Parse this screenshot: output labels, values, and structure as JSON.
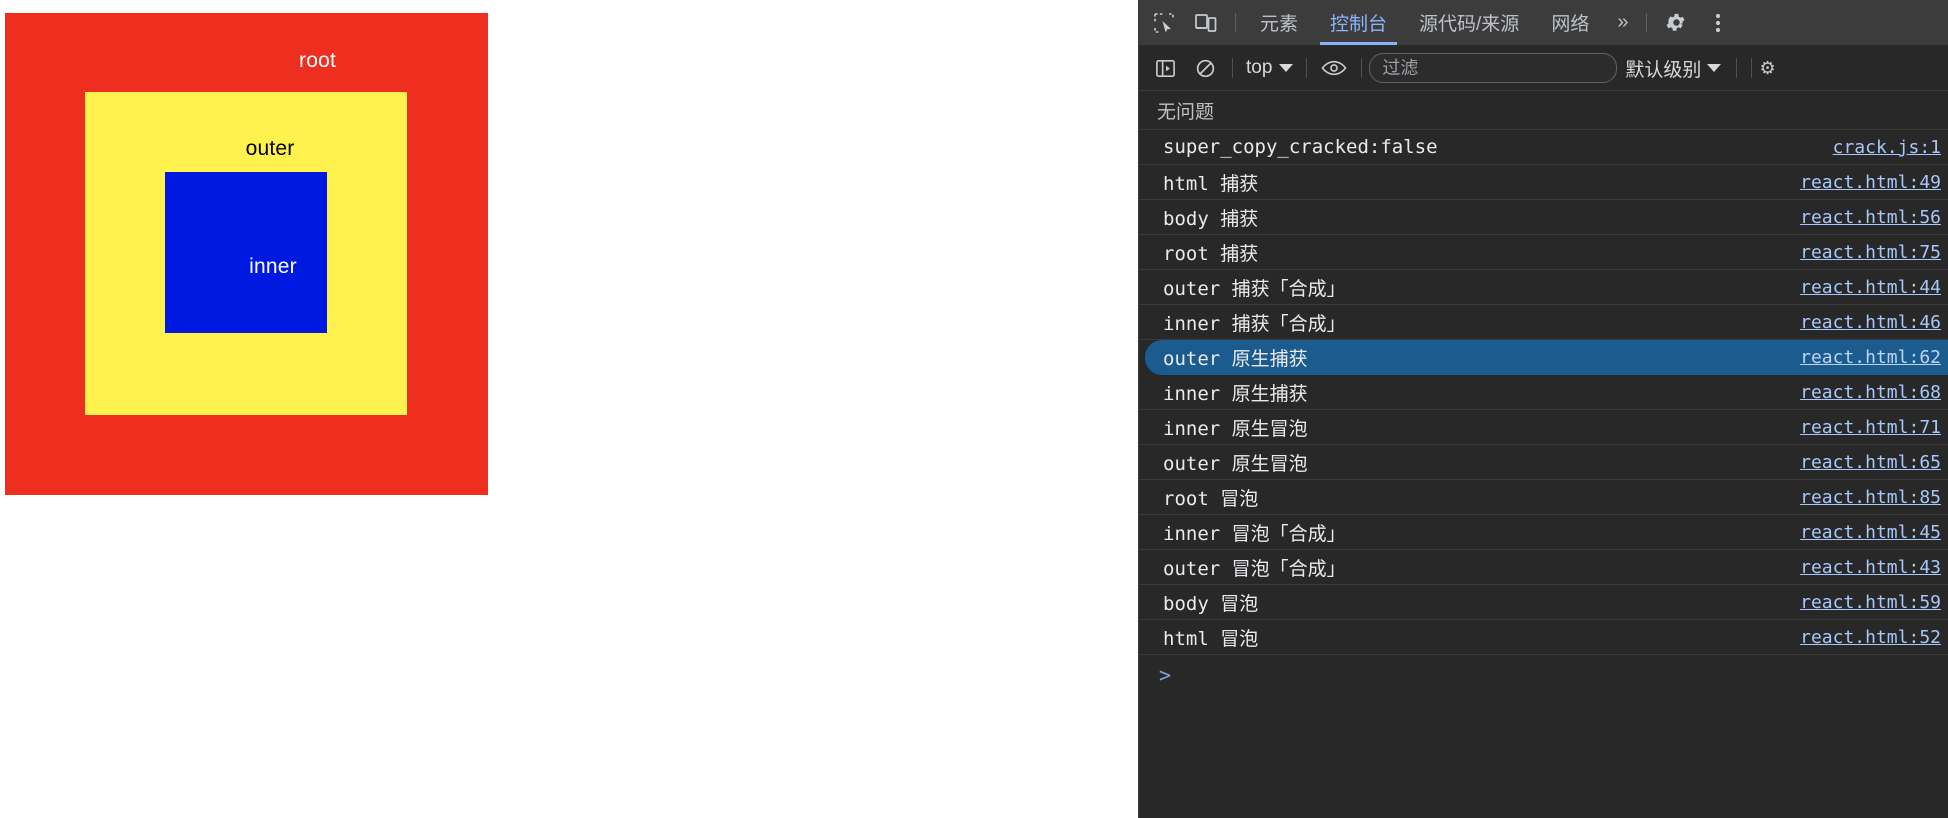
{
  "demo_page": {
    "boxes": [
      {
        "name": "root",
        "label": "root",
        "color": "#ee2e1f"
      },
      {
        "name": "outer",
        "label": "outer",
        "color": "#fff24f"
      },
      {
        "name": "inner",
        "label": "inner",
        "color": "#0019e0"
      }
    ]
  },
  "devtools": {
    "tabs": [
      {
        "label": "元素",
        "active": false
      },
      {
        "label": "控制台",
        "active": true
      },
      {
        "label": "源代码/来源",
        "active": false
      },
      {
        "label": "网络",
        "active": false
      }
    ],
    "more_tabs_label": "»",
    "icons": {
      "inspect": "inspect-element-icon",
      "device": "device-toolbar-icon",
      "settings": "gear-icon",
      "menu": "kebab-menu-icon",
      "sidebar": "console-sidebar-icon",
      "clear": "clear-console-icon",
      "eye": "live-expression-icon"
    },
    "filter_toolbar": {
      "context_value": "top",
      "filter_placeholder": "过滤",
      "filter_value": "",
      "level_value": "默认级别"
    },
    "issues_status": "无问题",
    "prompt_caret": ">",
    "selected_row_index": 6,
    "accent_color": "#8ab4f8",
    "selection_color": "#1b5b8d",
    "console_rows": [
      {
        "message": "super_copy_cracked:false",
        "source": "crack.js:1"
      },
      {
        "message": "html 捕获",
        "source": "react.html:49"
      },
      {
        "message": "body 捕获",
        "source": "react.html:56"
      },
      {
        "message": "root 捕获",
        "source": "react.html:75"
      },
      {
        "message": "outer 捕获「合成」",
        "source": "react.html:44"
      },
      {
        "message": "inner 捕获「合成」",
        "source": "react.html:46"
      },
      {
        "message": "outer 原生捕获",
        "source": "react.html:62"
      },
      {
        "message": "inner 原生捕获",
        "source": "react.html:68"
      },
      {
        "message": "inner 原生冒泡",
        "source": "react.html:71"
      },
      {
        "message": "outer 原生冒泡",
        "source": "react.html:65"
      },
      {
        "message": "root 冒泡",
        "source": "react.html:85"
      },
      {
        "message": "inner 冒泡「合成」",
        "source": "react.html:45"
      },
      {
        "message": "outer 冒泡「合成」",
        "source": "react.html:43"
      },
      {
        "message": "body 冒泡",
        "source": "react.html:59"
      },
      {
        "message": "html 冒泡",
        "source": "react.html:52"
      }
    ]
  }
}
